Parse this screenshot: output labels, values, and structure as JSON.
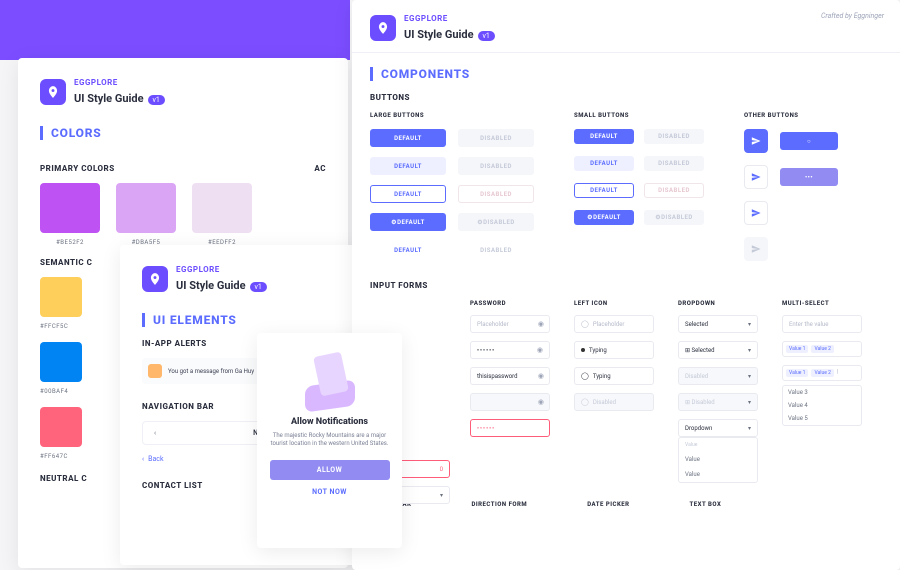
{
  "brand": {
    "name": "EGGPLORE",
    "subtitle": "UI Style Guide",
    "pill": "v1",
    "crafted": "Crafted by Eggninger"
  },
  "sections": {
    "colors": "COLORS",
    "ui": "UI ELEMENTS",
    "components": "COMPONENTS"
  },
  "colors": {
    "primary_title": "PRIMARY COLORS",
    "ac_title": "AC",
    "semantic_title": "SEMANTIC C",
    "neutral_title": "NEUTRAL C",
    "swatches": {
      "p1": {
        "hex": "#BE52F2",
        "label": "#BE52F2"
      },
      "p2": {
        "hex": "#DBA5F5",
        "label": "#DBA5F5"
      },
      "p3": {
        "hex": "#EEDFF2",
        "label": "#EEDFF2"
      },
      "s1": {
        "hex": "#FFCF5C",
        "label": "#FFCF5C"
      },
      "s2": {
        "hex": "#0084F4",
        "label": "#00BAF4"
      },
      "s3": {
        "hex": "#FF647C",
        "label": "#FF647C"
      }
    }
  },
  "ui": {
    "alerts_title": "IN-APP ALERTS",
    "alert_text": "You got a message from Ga Huy",
    "nav_title": "NAVIGATION BAR",
    "nav_label": "Navigation",
    "back_label": "Back",
    "contact_title": "CONTACT LIST"
  },
  "notif": {
    "title": "Allow Notifications",
    "text": "The majestic Rocky Mountains are a major tourist location in the western United States.",
    "allow": "ALLOW",
    "not_now": "NOT NOW"
  },
  "components": {
    "buttons_title": "BUTTONS",
    "large_title": "LARGE BUTTONS",
    "small_title": "SMALL BUTTONS",
    "other_title": "OTHER BUTTONS",
    "default": "DEFAULT",
    "disabled": "DISABLED",
    "forms_title": "INPUT FORMS",
    "password_title": "PASSWORD",
    "lefticon_title": "LEFT ICON",
    "dropdown_title": "DROPDOWN",
    "multi_title": "MULTI-SELECT",
    "placeholder": "Placeholder",
    "typing": "Typing",
    "thispass": "thisispassword",
    "selected": "Selected",
    "dropdown_label": "Dropdown",
    "value": "Value",
    "value1": "Value 1",
    "value2": "Value 2",
    "value3": "Value 3",
    "value4": "Value 4",
    "value5": "Value 5",
    "enter": "Enter the value",
    "disabled_dd": "Disabled",
    "search_title": "SEARCH BAR",
    "direction_title": "DIRECTION FORM",
    "date_title": "DATE PICKER",
    "text_title": "TEXT BOX"
  }
}
